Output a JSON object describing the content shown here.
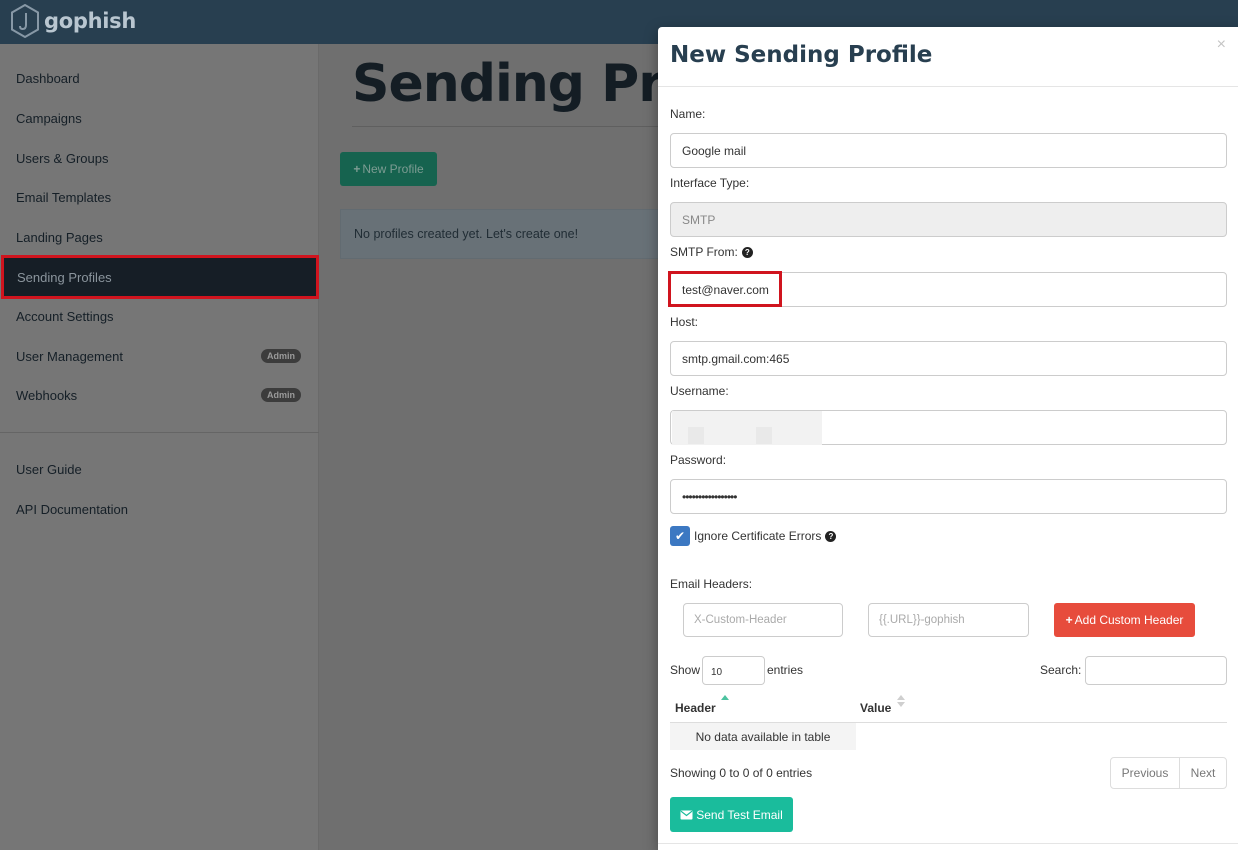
{
  "app": {
    "brand": "gophish"
  },
  "sidebar": {
    "items": [
      {
        "label": "Dashboard"
      },
      {
        "label": "Campaigns"
      },
      {
        "label": "Users & Groups"
      },
      {
        "label": "Email Templates"
      },
      {
        "label": "Landing Pages"
      },
      {
        "label": "Sending Profiles",
        "active": true
      },
      {
        "label": "Account Settings"
      },
      {
        "label": "User Management",
        "badge": "Admin"
      },
      {
        "label": "Webhooks",
        "badge": "Admin"
      }
    ],
    "footer_items": [
      {
        "label": "User Guide"
      },
      {
        "label": "API Documentation"
      }
    ]
  },
  "main": {
    "title": "Sending Profiles",
    "new_profile_label": "New Profile",
    "empty_message": "No profiles created yet. Let's create one!"
  },
  "modal": {
    "title": "New Sending Profile",
    "close": "×",
    "name_label": "Name:",
    "name_value": "Google mail",
    "interface_label": "Interface Type:",
    "interface_value": "SMTP",
    "from_label": "SMTP From:",
    "from_value": "test@naver.com",
    "host_label": "Host:",
    "host_value": "smtp.gmail.com:465",
    "username_label": "Username:",
    "username_value": "",
    "password_label": "Password:",
    "password_value": "•••••••••••••••••",
    "ignore_cert_label": "Ignore Certificate Errors",
    "ignore_cert_checked": true,
    "headers_label": "Email Headers:",
    "header_placeholder": "X-Custom-Header",
    "value_placeholder": "{{.URL}}-gophish",
    "add_header_label": "Add Custom Header",
    "table": {
      "show_label": "Show",
      "entries_value": "10",
      "entries_label": "entries",
      "search_label": "Search:",
      "columns": [
        "Header",
        "Value"
      ],
      "empty_text": "No data available in table",
      "info": "Showing 0 to 0 of 0 entries",
      "previous": "Previous",
      "next": "Next"
    },
    "send_test_label": "Send Test Email"
  },
  "colors": {
    "navbar": "#283f50",
    "accent": "#1abc9c",
    "danger": "#e74c3c",
    "highlight": "#d0141e",
    "checkbox": "#3c78c2"
  }
}
